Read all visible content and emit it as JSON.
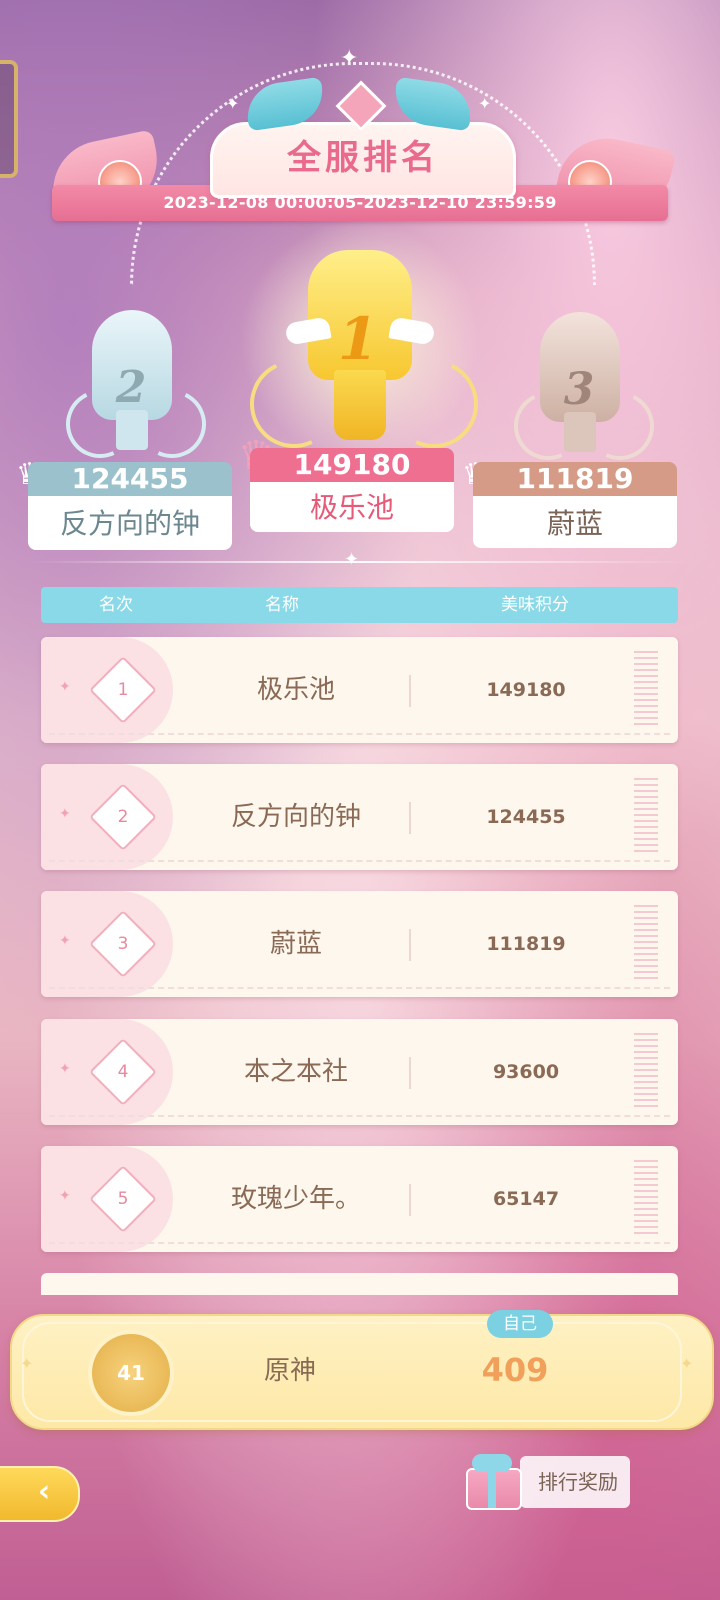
{
  "header": {
    "title": "全服排名",
    "date_range": "2023-12-08 00:00:05-2023-12-10 23:59:59"
  },
  "podium": [
    {
      "rank": "2",
      "score": "124455",
      "name": "反方向的钟",
      "color": "#9bc2cc"
    },
    {
      "rank": "1",
      "score": "149180",
      "name": "极乐池",
      "color": "#ef6f90"
    },
    {
      "rank": "3",
      "score": "111819",
      "name": "蔚蓝",
      "color": "#d59b86"
    }
  ],
  "table": {
    "headers": [
      "名次",
      "名称",
      "美味积分"
    ],
    "rows": [
      {
        "rank": "1",
        "name": "极乐池",
        "score": "149180"
      },
      {
        "rank": "2",
        "name": "反方向的钟",
        "score": "124455"
      },
      {
        "rank": "3",
        "name": "蔚蓝",
        "score": "111819"
      },
      {
        "rank": "4",
        "name": "本之本社",
        "score": "93600"
      },
      {
        "rank": "5",
        "name": "玫瑰少年。",
        "score": "65147"
      }
    ]
  },
  "self": {
    "badge": "自己",
    "rank": "41",
    "name": "原神",
    "score": "409"
  },
  "footer": {
    "reward_button": "排行奖励",
    "back_icon": "back-arrow-icon",
    "gift_icon": "gift-box-icon"
  },
  "colors": {
    "title_pink": "#e96a8d",
    "header_cyan": "#8ad9e8",
    "row_text": "#8a6a55",
    "self_score": "#f0a05a"
  }
}
